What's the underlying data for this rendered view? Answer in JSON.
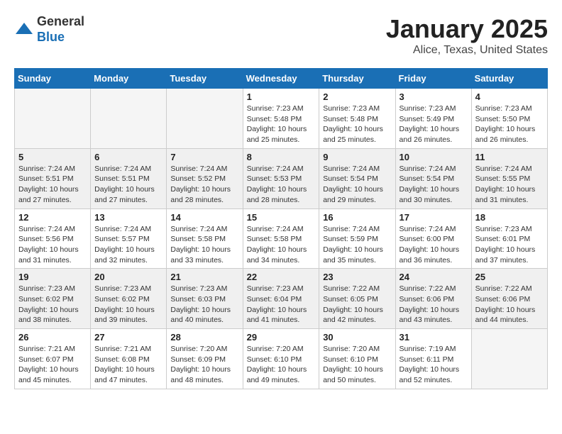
{
  "header": {
    "logo_general": "General",
    "logo_blue": "Blue",
    "title": "January 2025",
    "subtitle": "Alice, Texas, United States"
  },
  "days_of_week": [
    "Sunday",
    "Monday",
    "Tuesday",
    "Wednesday",
    "Thursday",
    "Friday",
    "Saturday"
  ],
  "weeks": [
    {
      "shaded": false,
      "days": [
        {
          "num": "",
          "detail": ""
        },
        {
          "num": "",
          "detail": ""
        },
        {
          "num": "",
          "detail": ""
        },
        {
          "num": "1",
          "detail": "Sunrise: 7:23 AM\nSunset: 5:48 PM\nDaylight: 10 hours\nand 25 minutes."
        },
        {
          "num": "2",
          "detail": "Sunrise: 7:23 AM\nSunset: 5:48 PM\nDaylight: 10 hours\nand 25 minutes."
        },
        {
          "num": "3",
          "detail": "Sunrise: 7:23 AM\nSunset: 5:49 PM\nDaylight: 10 hours\nand 26 minutes."
        },
        {
          "num": "4",
          "detail": "Sunrise: 7:23 AM\nSunset: 5:50 PM\nDaylight: 10 hours\nand 26 minutes."
        }
      ]
    },
    {
      "shaded": true,
      "days": [
        {
          "num": "5",
          "detail": "Sunrise: 7:24 AM\nSunset: 5:51 PM\nDaylight: 10 hours\nand 27 minutes."
        },
        {
          "num": "6",
          "detail": "Sunrise: 7:24 AM\nSunset: 5:51 PM\nDaylight: 10 hours\nand 27 minutes."
        },
        {
          "num": "7",
          "detail": "Sunrise: 7:24 AM\nSunset: 5:52 PM\nDaylight: 10 hours\nand 28 minutes."
        },
        {
          "num": "8",
          "detail": "Sunrise: 7:24 AM\nSunset: 5:53 PM\nDaylight: 10 hours\nand 28 minutes."
        },
        {
          "num": "9",
          "detail": "Sunrise: 7:24 AM\nSunset: 5:54 PM\nDaylight: 10 hours\nand 29 minutes."
        },
        {
          "num": "10",
          "detail": "Sunrise: 7:24 AM\nSunset: 5:54 PM\nDaylight: 10 hours\nand 30 minutes."
        },
        {
          "num": "11",
          "detail": "Sunrise: 7:24 AM\nSunset: 5:55 PM\nDaylight: 10 hours\nand 31 minutes."
        }
      ]
    },
    {
      "shaded": false,
      "days": [
        {
          "num": "12",
          "detail": "Sunrise: 7:24 AM\nSunset: 5:56 PM\nDaylight: 10 hours\nand 31 minutes."
        },
        {
          "num": "13",
          "detail": "Sunrise: 7:24 AM\nSunset: 5:57 PM\nDaylight: 10 hours\nand 32 minutes."
        },
        {
          "num": "14",
          "detail": "Sunrise: 7:24 AM\nSunset: 5:58 PM\nDaylight: 10 hours\nand 33 minutes."
        },
        {
          "num": "15",
          "detail": "Sunrise: 7:24 AM\nSunset: 5:58 PM\nDaylight: 10 hours\nand 34 minutes."
        },
        {
          "num": "16",
          "detail": "Sunrise: 7:24 AM\nSunset: 5:59 PM\nDaylight: 10 hours\nand 35 minutes."
        },
        {
          "num": "17",
          "detail": "Sunrise: 7:24 AM\nSunset: 6:00 PM\nDaylight: 10 hours\nand 36 minutes."
        },
        {
          "num": "18",
          "detail": "Sunrise: 7:23 AM\nSunset: 6:01 PM\nDaylight: 10 hours\nand 37 minutes."
        }
      ]
    },
    {
      "shaded": true,
      "days": [
        {
          "num": "19",
          "detail": "Sunrise: 7:23 AM\nSunset: 6:02 PM\nDaylight: 10 hours\nand 38 minutes."
        },
        {
          "num": "20",
          "detail": "Sunrise: 7:23 AM\nSunset: 6:02 PM\nDaylight: 10 hours\nand 39 minutes."
        },
        {
          "num": "21",
          "detail": "Sunrise: 7:23 AM\nSunset: 6:03 PM\nDaylight: 10 hours\nand 40 minutes."
        },
        {
          "num": "22",
          "detail": "Sunrise: 7:23 AM\nSunset: 6:04 PM\nDaylight: 10 hours\nand 41 minutes."
        },
        {
          "num": "23",
          "detail": "Sunrise: 7:22 AM\nSunset: 6:05 PM\nDaylight: 10 hours\nand 42 minutes."
        },
        {
          "num": "24",
          "detail": "Sunrise: 7:22 AM\nSunset: 6:06 PM\nDaylight: 10 hours\nand 43 minutes."
        },
        {
          "num": "25",
          "detail": "Sunrise: 7:22 AM\nSunset: 6:06 PM\nDaylight: 10 hours\nand 44 minutes."
        }
      ]
    },
    {
      "shaded": false,
      "days": [
        {
          "num": "26",
          "detail": "Sunrise: 7:21 AM\nSunset: 6:07 PM\nDaylight: 10 hours\nand 45 minutes."
        },
        {
          "num": "27",
          "detail": "Sunrise: 7:21 AM\nSunset: 6:08 PM\nDaylight: 10 hours\nand 47 minutes."
        },
        {
          "num": "28",
          "detail": "Sunrise: 7:20 AM\nSunset: 6:09 PM\nDaylight: 10 hours\nand 48 minutes."
        },
        {
          "num": "29",
          "detail": "Sunrise: 7:20 AM\nSunset: 6:10 PM\nDaylight: 10 hours\nand 49 minutes."
        },
        {
          "num": "30",
          "detail": "Sunrise: 7:20 AM\nSunset: 6:10 PM\nDaylight: 10 hours\nand 50 minutes."
        },
        {
          "num": "31",
          "detail": "Sunrise: 7:19 AM\nSunset: 6:11 PM\nDaylight: 10 hours\nand 52 minutes."
        },
        {
          "num": "",
          "detail": ""
        }
      ]
    }
  ]
}
